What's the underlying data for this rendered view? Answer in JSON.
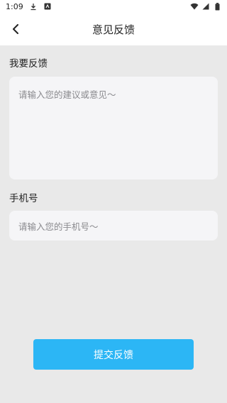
{
  "status_bar": {
    "time": "1:09",
    "icons": [
      "download-icon",
      "notification-icon",
      "wifi-icon",
      "signal-icon",
      "battery-icon"
    ]
  },
  "header": {
    "back_icon": "chevron-left-icon",
    "title": "意见反馈"
  },
  "form": {
    "feedback_label": "我要反馈",
    "feedback_placeholder": "请输入您的建议或意见～",
    "phone_label": "手机号",
    "phone_placeholder": "请输入您的手机号～",
    "submit_label": "提交反馈"
  },
  "colors": {
    "background": "#e9e9e9",
    "field_background": "#f5f5f7",
    "primary_button": "#2cb6f5",
    "placeholder_text": "#8a8a8e"
  }
}
